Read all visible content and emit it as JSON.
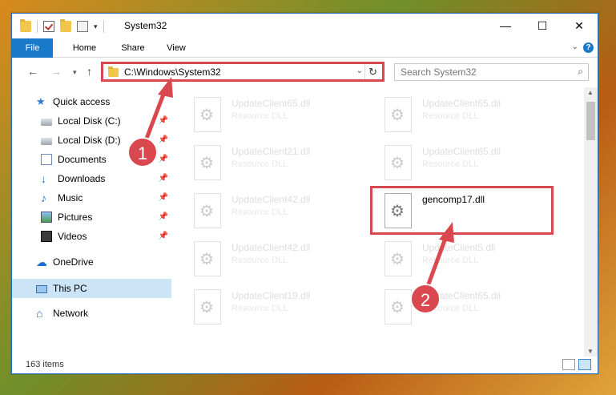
{
  "window": {
    "title": "System32",
    "controls": {
      "minimize": "—",
      "maximize": "☐",
      "close": "✕"
    }
  },
  "ribbon": {
    "tabs": [
      {
        "label": "File"
      },
      {
        "label": "Home"
      },
      {
        "label": "Share"
      },
      {
        "label": "View"
      }
    ],
    "help": "?"
  },
  "navigation": {
    "address": "C:\\Windows\\System32",
    "search_placeholder": "Search System32"
  },
  "sidebar": {
    "items": [
      {
        "label": "Quick access"
      },
      {
        "label": "Local Disk (C:)"
      },
      {
        "label": "Local Disk (D:)"
      },
      {
        "label": "Documents"
      },
      {
        "label": "Downloads"
      },
      {
        "label": "Music"
      },
      {
        "label": "Pictures"
      },
      {
        "label": "Videos"
      },
      {
        "label": "OneDrive"
      },
      {
        "label": "This PC"
      },
      {
        "label": "Network"
      }
    ],
    "selected": "This PC"
  },
  "files": [
    {
      "name": "UpdateClient65.dll",
      "type": "Resource DLL"
    },
    {
      "name": "UpdateClient65.dll",
      "type": "Resource DLL"
    },
    {
      "name": "UpdateClient21.dll",
      "type": "Resource DLL"
    },
    {
      "name": "UpdateClient65.dll",
      "type": "Resource DLL"
    },
    {
      "name": "UpdateClient42.dll",
      "type": "Resource DLL"
    },
    {
      "name": "gencomp17.dll",
      "type": ""
    },
    {
      "name": "UpdateClient42.dll",
      "type": "Resource DLL"
    },
    {
      "name": "UpdateClient5.dll",
      "type": "Resource DLL"
    },
    {
      "name": "UpdateClient19.dll",
      "type": "Resource DLL"
    },
    {
      "name": "UpdateClient65.dll",
      "type": "Resource DLL"
    }
  ],
  "status": {
    "item_count": "163 items"
  },
  "callouts": {
    "one": "1",
    "two": "2"
  },
  "colors": {
    "accent": "#1979ca",
    "highlight": "#d9484f",
    "selected_bg": "#cce4f7"
  }
}
